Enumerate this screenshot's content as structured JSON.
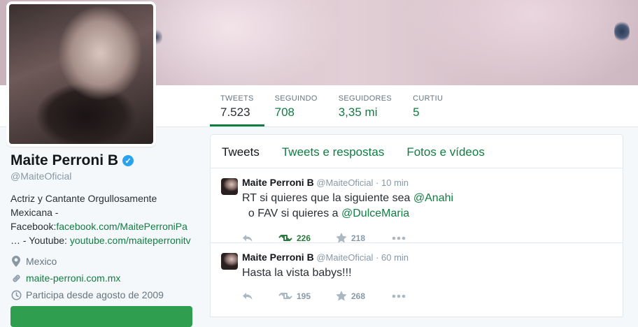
{
  "colors": {
    "accent": "#0f7d42",
    "verified": "#2aa3ef"
  },
  "stats": [
    {
      "label": "TWEETS",
      "value": "7.523"
    },
    {
      "label": "SEGUINDO",
      "value": "708"
    },
    {
      "label": "SEGUIDORES",
      "value": "3,35 mi"
    },
    {
      "label": "CURTIU",
      "value": "5"
    }
  ],
  "profile": {
    "name": "Maite Perroni B",
    "handle": "@MaiteOficial",
    "bio_text_1": "Actriz y Cantante Orgullosamente Mexicana - Facebook:",
    "bio_link_1": "facebook.com/MaitePerroniPa",
    "bio_text_2": "… - Youtube: ",
    "bio_link_2": "youtube.com/maiteperronitv",
    "location": "Mexico",
    "website": "maite-perroni.com.mx",
    "joined": "Participa desde agosto de 2009"
  },
  "tabs": [
    "Tweets",
    "Tweets e respostas",
    "Fotos e vídeos"
  ],
  "tweets": [
    {
      "author": "Maite Perroni B",
      "handle": "@MaiteOficial",
      "time": "· 10 min",
      "text_1": "RT si quieres que la siguiente sea ",
      "mention_1": "@Anahi",
      "text_2": "  o FAV si quieres a ",
      "mention_2": "@DulceMaria",
      "retweets": "226",
      "likes": "218"
    },
    {
      "author": "Maite Perroni B",
      "handle": "@MaiteOficial",
      "time": "· 60 min",
      "text": "Hasta la vista babys!!!",
      "retweets": "195",
      "likes": "268"
    }
  ]
}
